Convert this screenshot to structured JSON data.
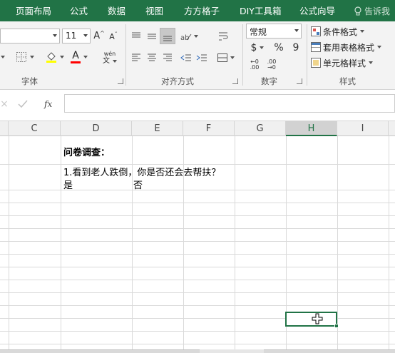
{
  "ribbon_tabs": [
    "页面布局",
    "公式",
    "数据",
    "视图",
    "方方格子",
    "DIY工具箱",
    "公式向导"
  ],
  "tell_me": "告诉我",
  "font": {
    "size_value": "11",
    "grow_label": "A",
    "shrink_label": "A",
    "color_letter": "A",
    "phonetic_top": "wén",
    "phonetic_bottom": "文",
    "group_label": "字体"
  },
  "alignment": {
    "group_label": "对齐方式"
  },
  "number": {
    "format_value": "常规",
    "currency": "$",
    "percent": "%",
    "comma": "9",
    "inc_decimal_top": "←0",
    "inc_decimal_bottom": ".00",
    "dec_decimal_top": ".00",
    "dec_decimal_bottom": "→0",
    "group_label": "数字"
  },
  "styles": {
    "conditional_format": "条件格式",
    "table_format": "套用表格格式",
    "cell_styles": "单元格样式",
    "group_label": "样式"
  },
  "formula_bar": {
    "fx": "fx",
    "value": ""
  },
  "columns": [
    "C",
    "D",
    "E",
    "F",
    "G",
    "H",
    "I"
  ],
  "active_column": "H",
  "cells": {
    "title": "问卷调查：",
    "question": "1.看到老人跌倒，你是否还会去帮扶？",
    "option_yes": "是",
    "option_no": "否"
  },
  "colors": {
    "ribbon_green": "#217346",
    "fill_color": "#ffff00",
    "font_color": "#ff0000"
  }
}
